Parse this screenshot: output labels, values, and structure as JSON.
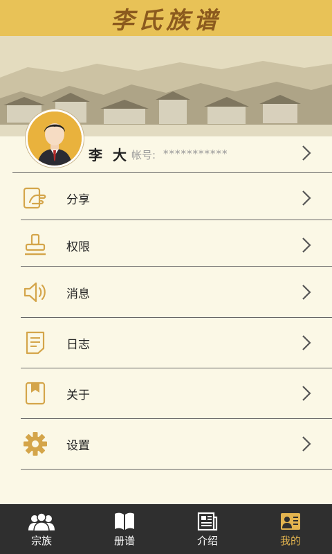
{
  "header": {
    "title": "李氏族谱"
  },
  "profile": {
    "name": "李 大",
    "account_label": "帐号:",
    "account_value": "***********"
  },
  "menu": [
    {
      "label": "分享",
      "icon": "share-hand-icon"
    },
    {
      "label": "权限",
      "icon": "stamp-icon"
    },
    {
      "label": "消息",
      "icon": "speaker-icon"
    },
    {
      "label": "日志",
      "icon": "document-icon"
    },
    {
      "label": "关于",
      "icon": "bookmark-icon"
    },
    {
      "label": "设置",
      "icon": "gear-icon"
    }
  ],
  "tabs": [
    {
      "label": "宗族",
      "icon": "group-icon",
      "active": false
    },
    {
      "label": "册谱",
      "icon": "book-icon",
      "active": false
    },
    {
      "label": "介绍",
      "icon": "newspaper-icon",
      "active": false
    },
    {
      "label": "我的",
      "icon": "profile-card-icon",
      "active": true
    }
  ],
  "colors": {
    "header_bg": "#e8c257",
    "accent": "#e3b44f",
    "tabbar_bg": "#2f2f2f",
    "icon": "#d4a54a"
  }
}
